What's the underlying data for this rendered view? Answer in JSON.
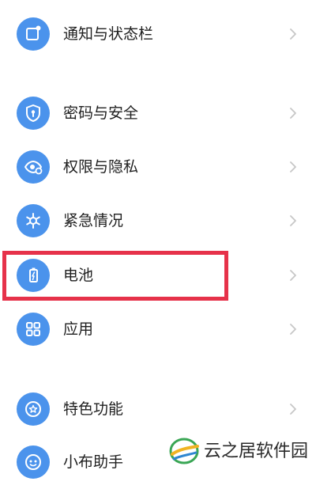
{
  "settings": {
    "items": [
      {
        "label": "通知与状态栏",
        "icon": "notification-icon"
      },
      {
        "label": "密码与安全",
        "icon": "shield-icon"
      },
      {
        "label": "权限与隐私",
        "icon": "privacy-eye-icon"
      },
      {
        "label": "紧急情况",
        "icon": "emergency-icon"
      },
      {
        "label": "电池",
        "icon": "battery-icon"
      },
      {
        "label": "应用",
        "icon": "apps-grid-icon"
      },
      {
        "label": "特色功能",
        "icon": "star-icon"
      },
      {
        "label": "小布助手",
        "icon": "assistant-icon"
      }
    ]
  },
  "colors": {
    "icon_bg": "#4b93ec",
    "highlight_border": "#e6324a",
    "chevron": "#c7c7c7"
  },
  "watermark": {
    "text": "云之居软件园"
  }
}
